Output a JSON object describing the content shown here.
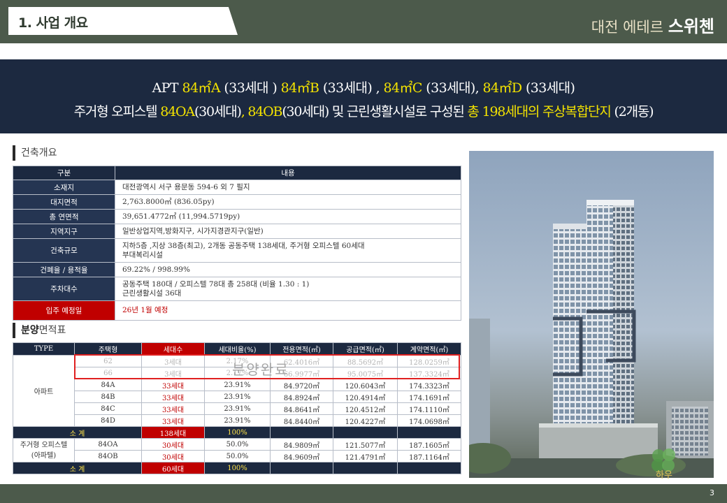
{
  "header": {
    "section_title": "1. 사업 개요",
    "brand_prefix": "대전 에테르 ",
    "brand_accent": "스위첸"
  },
  "banner": {
    "line1": {
      "a": "APT ",
      "b": "84㎡A",
      "c": " (33세대 ) ",
      "d": "84㎡B",
      "e": " (33세대) , ",
      "f": "84㎡C",
      "g": " (33세대), ",
      "h": "84㎡D",
      "i": " (33세대)"
    },
    "line2": {
      "a": "주거형 오피스텔 ",
      "b": "84OA",
      "c": "(30세대)",
      "d": ", 84OB",
      "e": "(30세대) 및 근린생활시설로 구성된 ",
      "f": "총 198세대의 주상복합단지",
      "g": " (2개동)"
    }
  },
  "overview": {
    "heading": "건축개요",
    "col_key": "구분",
    "col_val": "내용",
    "rows": [
      {
        "key": "소재지",
        "value": "대전광역시 서구 용문동 594-6 외 7 필지"
      },
      {
        "key": "대지면적",
        "value": "2,763.8000㎡ (836.05py)"
      },
      {
        "key": "총 연면적",
        "value": "39,651.4772㎡ (11,994.5719py)"
      },
      {
        "key": "지역지구",
        "value": "일반상업지역,방화지구, 시가지경관지구(일반)"
      },
      {
        "key": "건축규모",
        "value": "지하5층 ,지상 38층(최고), 2개동 공동주택 138세대, 주거형 오피스텔 60세대",
        "value2": "부대복리시설"
      },
      {
        "key": "건폐율 / 용적율",
        "value": "69.22% / 998.99%"
      },
      {
        "key": "주차대수",
        "value": "공동주택 180대 / 오피스텔 78대  총 258대  (비율 1.30 : 1)",
        "value2": "근린생활시설 36대"
      },
      {
        "key": "입주 예정일",
        "value": "26년 1월 예정"
      }
    ]
  },
  "sales": {
    "heading_bold": "분양",
    "heading_rest": "면적표",
    "columns": [
      "TYPE",
      "주택형",
      "세대수",
      "세대비율(%)",
      "전용면적(㎡)",
      "공급면적(㎡)",
      "계약면적(㎡)"
    ],
    "group_apt": "아파트",
    "apt_rows": [
      {
        "type": "62",
        "units": "3세대",
        "ratio": "2.17%",
        "exclusive": "62.4016㎡",
        "supply": "88.5692㎡",
        "contract": "128.0259㎡"
      },
      {
        "type": "66",
        "units": "3세대",
        "ratio": "2.17%",
        "exclusive": "66.9977㎡",
        "supply": "95.0075㎡",
        "contract": "137.3324㎡"
      },
      {
        "type": "84A",
        "units": "33세대",
        "ratio": "23.91%",
        "exclusive": "84.9720㎡",
        "supply": "120.6043㎡",
        "contract": "174.3323㎡"
      },
      {
        "type": "84B",
        "units": "33세대",
        "ratio": "23.91%",
        "exclusive": "84.8924㎡",
        "supply": "120.4914㎡",
        "contract": "174.1691㎡"
      },
      {
        "type": "84C",
        "units": "33세대",
        "ratio": "23.91%",
        "exclusive": "84.8641㎡",
        "supply": "120.4512㎡",
        "contract": "174.1110㎡"
      },
      {
        "type": "84D",
        "units": "33세대",
        "ratio": "23.91%",
        "exclusive": "84.8440㎡",
        "supply": "120.4227㎡",
        "contract": "174.0698㎡"
      }
    ],
    "subtotal_label": "소 계",
    "apt_subtotal": {
      "units": "138세대",
      "ratio": "100%"
    },
    "group_off_1": "주거형 오피스텔",
    "group_off_2": "(아파텔)",
    "off_rows": [
      {
        "type": "84OA",
        "units": "30세대",
        "ratio": "50.0%",
        "exclusive": "84.9809㎡",
        "supply": "121.5077㎡",
        "contract": "187.1605㎡"
      },
      {
        "type": "84OB",
        "units": "30세대",
        "ratio": "50.0%",
        "exclusive": "84.9609㎡",
        "supply": "121.4791㎡",
        "contract": "187.1164㎡"
      }
    ],
    "off_subtotal": {
      "units": "60세대",
      "ratio": "100%"
    },
    "sold_stamp": "분양완료"
  },
  "footer": {
    "page_number": "3",
    "watermark": "하우"
  }
}
